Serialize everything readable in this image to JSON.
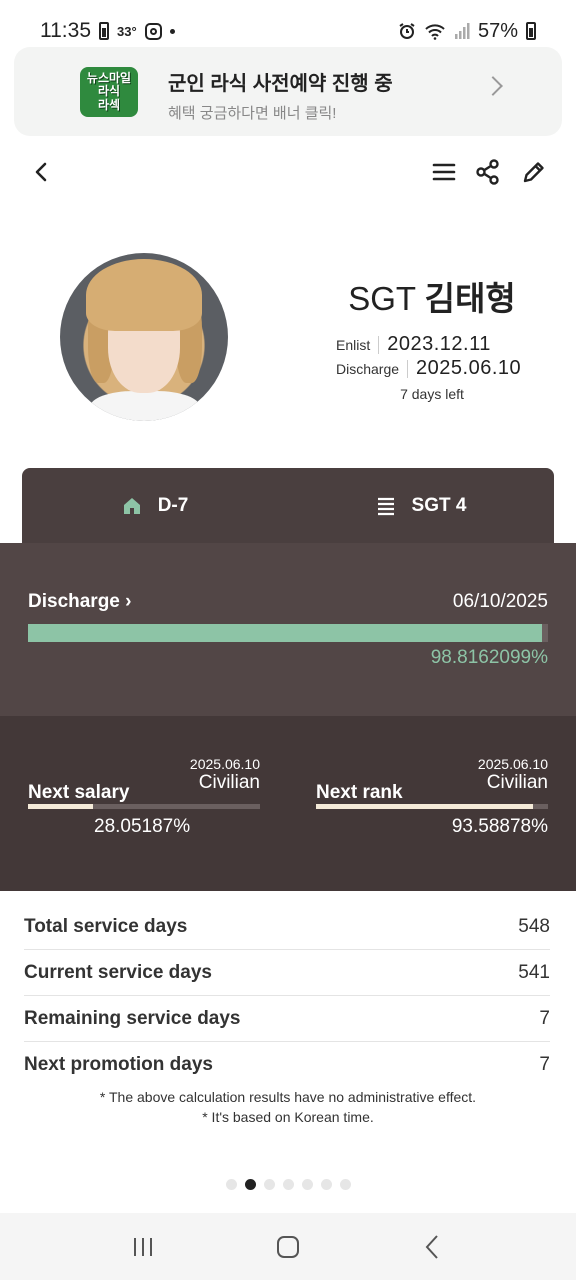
{
  "status_bar": {
    "time": "11:35",
    "temperature": "33°",
    "battery": "57%"
  },
  "banner": {
    "logo_lines": [
      "뉴스마일",
      "라식",
      "라섹"
    ],
    "title": "군인 라식 사전예약 진행 중",
    "subtitle": "혜택 궁금하다면 배너 클릭!"
  },
  "profile": {
    "rank": "SGT",
    "name": "김태형",
    "enlist_label": "Enlist",
    "enlist_date": "2023.12.11",
    "discharge_label": "Discharge",
    "discharge_date": "2025.06.10",
    "days_left": "7 days left"
  },
  "tabs": [
    {
      "label": "D-7",
      "icon": "home-icon"
    },
    {
      "label": "SGT 4",
      "icon": "list-icon"
    }
  ],
  "discharge": {
    "label": "Discharge",
    "date": "06/10/2025",
    "percent_text": "98.8162099%",
    "progress": 0.988162099
  },
  "next_salary": {
    "label": "Next salary",
    "date": "2025.06.10",
    "target": "Civilian",
    "percent_text": "28.05187%",
    "progress": 0.2805187
  },
  "next_rank": {
    "label": "Next rank",
    "date": "2025.06.10",
    "target": "Civilian",
    "percent_text": "93.58878%",
    "progress": 0.9358878
  },
  "stats": [
    {
      "label": "Total service days",
      "value": "548"
    },
    {
      "label": "Current service days",
      "value": "541"
    },
    {
      "label": "Remaining service days",
      "value": "7"
    },
    {
      "label": "Next promotion days",
      "value": "7"
    }
  ],
  "notes": [
    "* The above calculation results have no administrative effect.",
    "* It's based on Korean time."
  ],
  "colors": {
    "tab_bg": "#4a3f3f",
    "discharge_bg": "#524646",
    "next_bg": "#433838",
    "accent_green": "#8dc4a6",
    "accent_cream": "#f4ead8"
  },
  "pager": {
    "count": 7,
    "active_index": 1
  }
}
